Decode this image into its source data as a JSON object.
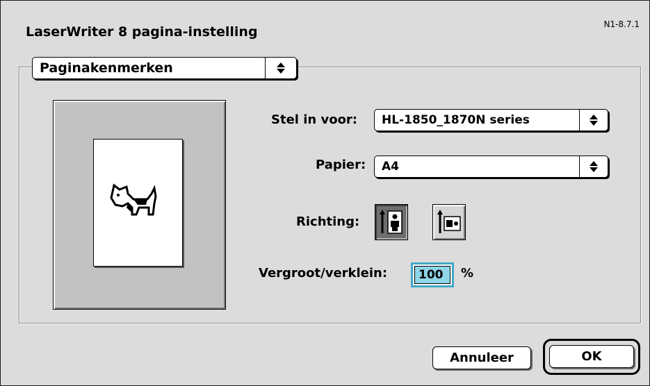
{
  "dialog": {
    "title": "LaserWriter 8 pagina-instelling",
    "version": "N1-8.7.1"
  },
  "section_popup": {
    "value": "Paginakenmerken",
    "arrow": "⇕"
  },
  "preview": {
    "icon": "dogcow-icon"
  },
  "fields": {
    "format_for": {
      "label": "Stel in voor:",
      "value": "HL-1850_1870N series"
    },
    "paper": {
      "label": "Papier:",
      "value": "A4"
    },
    "orientation": {
      "label": "Richting:",
      "selected": "portrait",
      "options": [
        "portrait-icon",
        "landscape-icon"
      ]
    },
    "scale": {
      "label": "Vergroot/verklein:",
      "value": "100",
      "unit": "%"
    }
  },
  "buttons": {
    "cancel": "Annuleer",
    "ok": "OK"
  },
  "colors": {
    "focus_ring": "#3fa9c7",
    "field_highlight": "#8fd5e8",
    "background": "#dcdcdc"
  }
}
